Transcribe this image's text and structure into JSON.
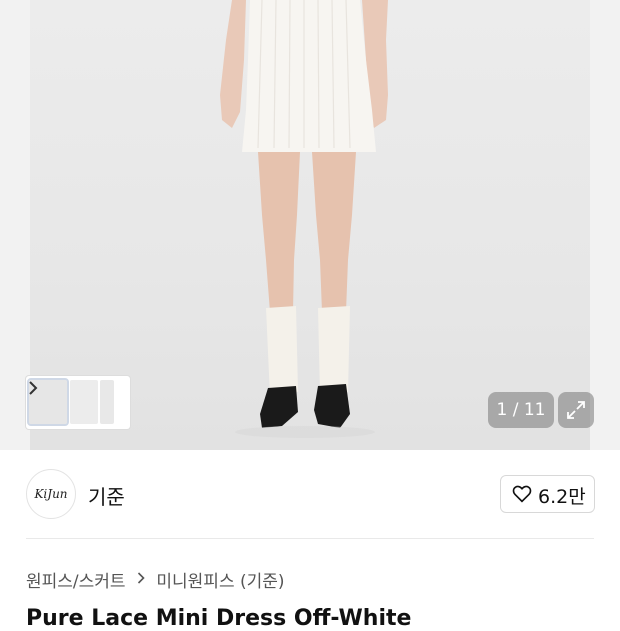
{
  "gallery": {
    "pager_text": "1 / 11"
  },
  "brand": {
    "logo_text": "KiJun",
    "name": "기준",
    "like_count": "6.2만"
  },
  "breadcrumb": {
    "items": [
      "원피스/스커트",
      "미니원피스 (기준)"
    ]
  },
  "product": {
    "title": "Pure Lace Mini Dress Off-White"
  },
  "colors": {
    "background": "#ffffff",
    "overlay": "#787878"
  }
}
